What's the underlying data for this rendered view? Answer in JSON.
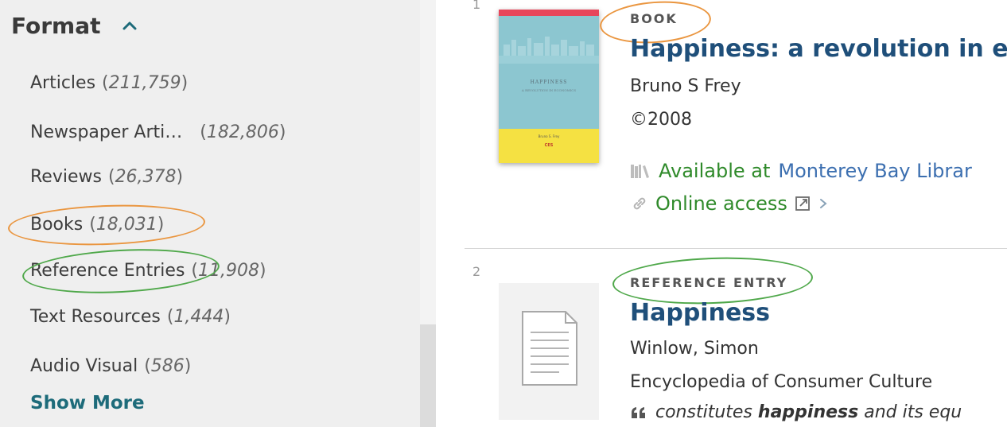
{
  "facet": {
    "title": "Format",
    "items": [
      {
        "label": "Articles",
        "count": "211,759"
      },
      {
        "label": "Newspaper Arti…",
        "count": "182,806"
      },
      {
        "label": "Reviews",
        "count": "26,378"
      },
      {
        "label": "Books",
        "count": "18,031"
      },
      {
        "label": "Reference Entries",
        "count": "11,908"
      },
      {
        "label": "Text Resources",
        "count": "1,444"
      },
      {
        "label": "Audio Visual",
        "count": "586"
      }
    ],
    "show_more": "Show More"
  },
  "results": [
    {
      "number": "1",
      "type": "BOOK",
      "title": "Happiness: a revolution in eco",
      "author": "Bruno S Frey",
      "date": "©2008",
      "availability_prefix": "Available at",
      "availability_library": "Monterey Bay Librar",
      "online_access": "Online access",
      "cover": {
        "title": "HAPPINESS",
        "subtitle": "A REVOLUTION IN ECONOMICS",
        "author": "Bruno S. Frey",
        "publisher": "CES"
      }
    },
    {
      "number": "2",
      "type": "REFERENCE ENTRY",
      "title": "Happiness",
      "author": "Winlow, Simon",
      "source": "Encyclopedia of Consumer Culture",
      "snippet_pre": "constitutes",
      "snippet_bold": "happiness",
      "snippet_post": "and its equ"
    }
  ],
  "colors": {
    "accent_teal": "#1d6b7a",
    "title_blue": "#1f4f7a",
    "available_green": "#2f8a2a",
    "link_blue": "#3c6fb0",
    "annotation_orange": "#ea9640",
    "annotation_green": "#4fa84a"
  }
}
